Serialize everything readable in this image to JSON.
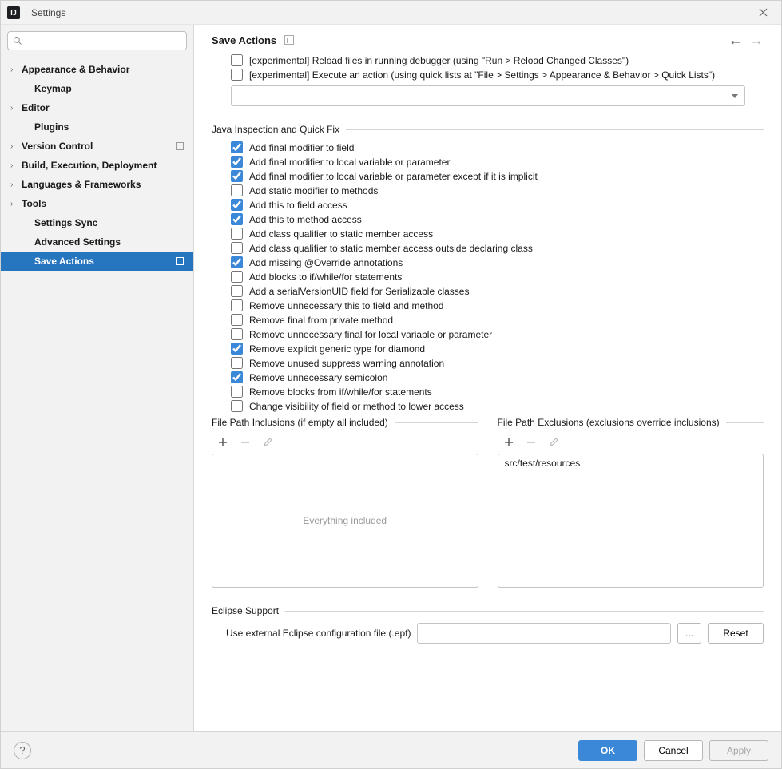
{
  "window": {
    "title": "Settings",
    "appicon_text": "IJ"
  },
  "search": {
    "placeholder": ""
  },
  "sidebar": {
    "items": [
      {
        "label": "Appearance & Behavior",
        "expandable": true,
        "child": false,
        "modified": false
      },
      {
        "label": "Keymap",
        "expandable": false,
        "child": true,
        "modified": false
      },
      {
        "label": "Editor",
        "expandable": true,
        "child": false,
        "modified": false
      },
      {
        "label": "Plugins",
        "expandable": false,
        "child": true,
        "modified": false
      },
      {
        "label": "Version Control",
        "expandable": true,
        "child": false,
        "modified": true
      },
      {
        "label": "Build, Execution, Deployment",
        "expandable": true,
        "child": false,
        "modified": false
      },
      {
        "label": "Languages & Frameworks",
        "expandable": true,
        "child": false,
        "modified": false
      },
      {
        "label": "Tools",
        "expandable": true,
        "child": false,
        "modified": false
      },
      {
        "label": "Settings Sync",
        "expandable": false,
        "child": true,
        "modified": false
      },
      {
        "label": "Advanced Settings",
        "expandable": false,
        "child": true,
        "modified": false
      },
      {
        "label": "Save Actions",
        "expandable": false,
        "child": true,
        "modified": true,
        "selected": true
      }
    ]
  },
  "breadcrumb": "Save Actions",
  "top_options": [
    {
      "label": "[experimental] Reload files in running debugger (using \"Run > Reload Changed Classes\")",
      "checked": false
    },
    {
      "label": "[experimental] Execute an action (using quick lists at \"File > Settings > Appearance & Behavior > Quick Lists\")",
      "checked": false
    }
  ],
  "sections": {
    "java": {
      "title": "Java Inspection and Quick Fix",
      "options": [
        {
          "label": "Add final modifier to field",
          "checked": true
        },
        {
          "label": "Add final modifier to local variable or parameter",
          "checked": true
        },
        {
          "label": "Add final modifier to local variable or parameter except if it is implicit",
          "checked": true
        },
        {
          "label": "Add static modifier to methods",
          "checked": false
        },
        {
          "label": "Add this to field access",
          "checked": true
        },
        {
          "label": "Add this to method access",
          "checked": true
        },
        {
          "label": "Add class qualifier to static member access",
          "checked": false
        },
        {
          "label": "Add class qualifier to static member access outside declaring class",
          "checked": false
        },
        {
          "label": "Add missing @Override annotations",
          "checked": true
        },
        {
          "label": "Add blocks to if/while/for statements",
          "checked": false
        },
        {
          "label": "Add a serialVersionUID field for Serializable classes",
          "checked": false
        },
        {
          "label": "Remove unnecessary this to field and method",
          "checked": false
        },
        {
          "label": "Remove final from private method",
          "checked": false
        },
        {
          "label": "Remove unnecessary final for local variable or parameter",
          "checked": false
        },
        {
          "label": "Remove explicit generic type for diamond",
          "checked": true
        },
        {
          "label": "Remove unused suppress warning annotation",
          "checked": false
        },
        {
          "label": "Remove unnecessary semicolon",
          "checked": true
        },
        {
          "label": "Remove blocks from if/while/for statements",
          "checked": false
        },
        {
          "label": "Change visibility of field or method to lower access",
          "checked": false
        }
      ]
    },
    "inclusions": {
      "title": "File Path Inclusions (if empty all included)",
      "placeholder": "Everything included",
      "items": []
    },
    "exclusions": {
      "title": "File Path Exclusions (exclusions override inclusions)",
      "items": [
        "src/test/resources"
      ]
    },
    "eclipse": {
      "title": "Eclipse Support",
      "field_label": "Use external Eclipse configuration file (.epf)",
      "browse": "...",
      "reset": "Reset"
    }
  },
  "footer": {
    "ok": "OK",
    "cancel": "Cancel",
    "apply": "Apply"
  }
}
